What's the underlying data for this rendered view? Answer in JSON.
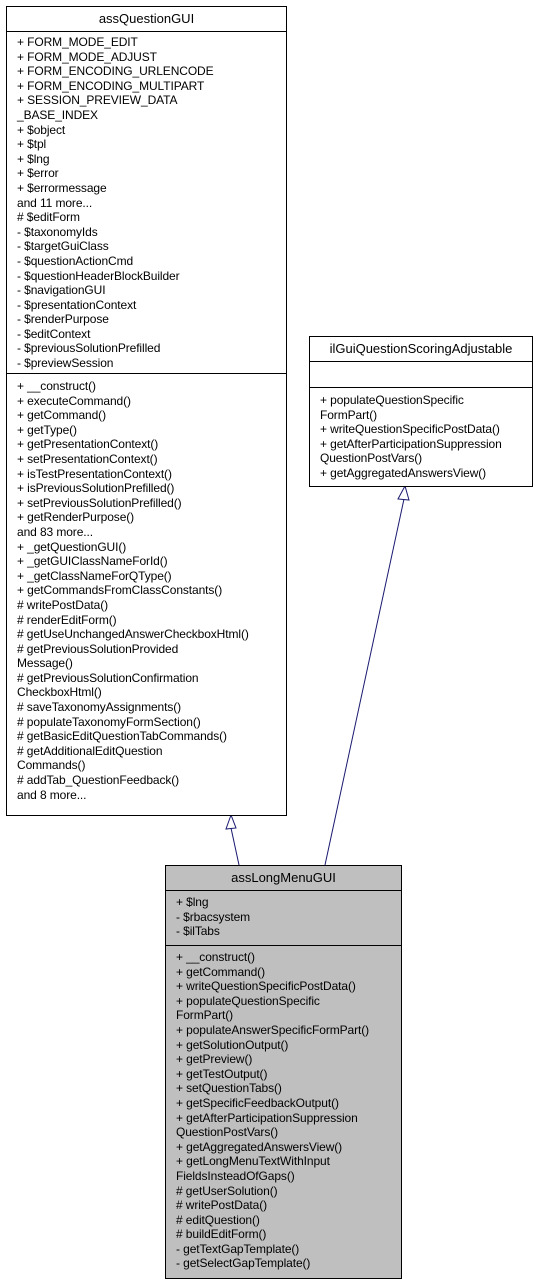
{
  "diagram": {
    "type": "class-inheritance",
    "edge_color": "#191970",
    "classes": {
      "base": {
        "name": "assQuestionGUI",
        "attributes": [
          "+ FORM_MODE_EDIT",
          "+ FORM_MODE_ADJUST",
          "+ FORM_ENCODING_URLENCODE",
          "+ FORM_ENCODING_MULTIPART",
          "+ SESSION_PREVIEW_DATA",
          "_BASE_INDEX",
          "+ $object",
          "+ $tpl",
          "+ $lng",
          "+ $error",
          "+ $errormessage",
          "and 11 more...",
          "# $editForm",
          "- $taxonomyIds",
          "- $targetGuiClass",
          "- $questionActionCmd",
          "- $questionHeaderBlockBuilder",
          "- $navigationGUI",
          "- $presentationContext",
          "- $renderPurpose",
          "- $editContext",
          "- $previousSolutionPrefilled",
          "- $previewSession"
        ],
        "methods": [
          "+ __construct()",
          "+ executeCommand()",
          "+ getCommand()",
          "+ getType()",
          "+ getPresentationContext()",
          "+ setPresentationContext()",
          "+ isTestPresentationContext()",
          "+ isPreviousSolutionPrefilled()",
          "+ setPreviousSolutionPrefilled()",
          "+ getRenderPurpose()",
          "and 83 more...",
          "+ _getQuestionGUI()",
          "+ _getGUIClassNameForId()",
          "+ _getClassNameForQType()",
          "+ getCommandsFromClassConstants()",
          "# writePostData()",
          "# renderEditForm()",
          "# getUseUnchangedAnswerCheckboxHtml()",
          "# getPreviousSolutionProvided",
          "Message()",
          "# getPreviousSolutionConfirmation",
          "CheckboxHtml()",
          "# saveTaxonomyAssignments()",
          "# populateTaxonomyFormSection()",
          "# getBasicEditQuestionTabCommands()",
          "# getAdditionalEditQuestion",
          "Commands()",
          "# addTab_QuestionFeedback()",
          "and 8 more..."
        ]
      },
      "interface": {
        "name": "ilGuiQuestionScoringAdjustable",
        "attributes": [],
        "methods": [
          "+ populateQuestionSpecific",
          "FormPart()",
          "+ writeQuestionSpecificPostData()",
          "+ getAfterParticipationSuppression",
          "QuestionPostVars()",
          "+ getAggregatedAnswersView()"
        ]
      },
      "derived": {
        "name": "assLongMenuGUI",
        "attributes": [
          "+ $lng",
          "- $rbacsystem",
          "- $ilTabs"
        ],
        "methods": [
          "+ __construct()",
          "+ getCommand()",
          "+ writeQuestionSpecificPostData()",
          "+ populateQuestionSpecific",
          "FormPart()",
          "+ populateAnswerSpecificFormPart()",
          "+ getSolutionOutput()",
          "+ getPreview()",
          "+ getTestOutput()",
          "+ setQuestionTabs()",
          "+ getSpecificFeedbackOutput()",
          "+ getAfterParticipationSuppression",
          "QuestionPostVars()",
          "+ getAggregatedAnswersView()",
          "+ getLongMenuTextWithInput",
          "FieldsInsteadOfGaps()",
          "# getUserSolution()",
          "# writePostData()",
          "# editQuestion()",
          "# buildEditForm()",
          "- getTextGapTemplate()",
          "- getSelectGapTemplate()"
        ]
      }
    },
    "edges": [
      {
        "from": "assLongMenuGUI",
        "to": "assQuestionGUI",
        "kind": "inheritance"
      },
      {
        "from": "assLongMenuGUI",
        "to": "ilGuiQuestionScoringAdjustable",
        "kind": "inheritance"
      }
    ]
  }
}
